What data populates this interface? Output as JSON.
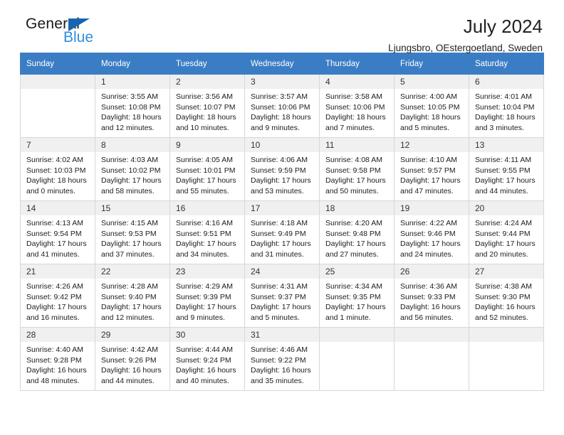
{
  "brand": {
    "word1": "General",
    "word2": "Blue",
    "triangle_color": "#1565b0",
    "word2_color": "#2e8ddb",
    "icon": "triangle-flag-icon"
  },
  "header": {
    "title": "July 2024",
    "subtitle": "Ljungsbro, OEstergoetland, Sweden"
  },
  "theme": {
    "header_row_bg": "#3b7dc4",
    "header_row_text": "#ffffff",
    "daynum_bg": "#f0f0f0",
    "cell_border": "#d7d7d7"
  },
  "calendar": {
    "weekday_headers": [
      "Sunday",
      "Monday",
      "Tuesday",
      "Wednesday",
      "Thursday",
      "Friday",
      "Saturday"
    ],
    "labels": {
      "sunrise": "Sunrise:",
      "sunset": "Sunset:",
      "daylight": "Daylight:"
    },
    "weeks": [
      [
        {
          "day": "",
          "empty": true
        },
        {
          "day": "1",
          "sunrise": "Sunrise: 3:55 AM",
          "sunset": "Sunset: 10:08 PM",
          "daylight1": "Daylight: 18 hours",
          "daylight2": "and 12 minutes."
        },
        {
          "day": "2",
          "sunrise": "Sunrise: 3:56 AM",
          "sunset": "Sunset: 10:07 PM",
          "daylight1": "Daylight: 18 hours",
          "daylight2": "and 10 minutes."
        },
        {
          "day": "3",
          "sunrise": "Sunrise: 3:57 AM",
          "sunset": "Sunset: 10:06 PM",
          "daylight1": "Daylight: 18 hours",
          "daylight2": "and 9 minutes."
        },
        {
          "day": "4",
          "sunrise": "Sunrise: 3:58 AM",
          "sunset": "Sunset: 10:06 PM",
          "daylight1": "Daylight: 18 hours",
          "daylight2": "and 7 minutes."
        },
        {
          "day": "5",
          "sunrise": "Sunrise: 4:00 AM",
          "sunset": "Sunset: 10:05 PM",
          "daylight1": "Daylight: 18 hours",
          "daylight2": "and 5 minutes."
        },
        {
          "day": "6",
          "sunrise": "Sunrise: 4:01 AM",
          "sunset": "Sunset: 10:04 PM",
          "daylight1": "Daylight: 18 hours",
          "daylight2": "and 3 minutes."
        }
      ],
      [
        {
          "day": "7",
          "sunrise": "Sunrise: 4:02 AM",
          "sunset": "Sunset: 10:03 PM",
          "daylight1": "Daylight: 18 hours",
          "daylight2": "and 0 minutes."
        },
        {
          "day": "8",
          "sunrise": "Sunrise: 4:03 AM",
          "sunset": "Sunset: 10:02 PM",
          "daylight1": "Daylight: 17 hours",
          "daylight2": "and 58 minutes."
        },
        {
          "day": "9",
          "sunrise": "Sunrise: 4:05 AM",
          "sunset": "Sunset: 10:01 PM",
          "daylight1": "Daylight: 17 hours",
          "daylight2": "and 55 minutes."
        },
        {
          "day": "10",
          "sunrise": "Sunrise: 4:06 AM",
          "sunset": "Sunset: 9:59 PM",
          "daylight1": "Daylight: 17 hours",
          "daylight2": "and 53 minutes."
        },
        {
          "day": "11",
          "sunrise": "Sunrise: 4:08 AM",
          "sunset": "Sunset: 9:58 PM",
          "daylight1": "Daylight: 17 hours",
          "daylight2": "and 50 minutes."
        },
        {
          "day": "12",
          "sunrise": "Sunrise: 4:10 AM",
          "sunset": "Sunset: 9:57 PM",
          "daylight1": "Daylight: 17 hours",
          "daylight2": "and 47 minutes."
        },
        {
          "day": "13",
          "sunrise": "Sunrise: 4:11 AM",
          "sunset": "Sunset: 9:55 PM",
          "daylight1": "Daylight: 17 hours",
          "daylight2": "and 44 minutes."
        }
      ],
      [
        {
          "day": "14",
          "sunrise": "Sunrise: 4:13 AM",
          "sunset": "Sunset: 9:54 PM",
          "daylight1": "Daylight: 17 hours",
          "daylight2": "and 41 minutes."
        },
        {
          "day": "15",
          "sunrise": "Sunrise: 4:15 AM",
          "sunset": "Sunset: 9:53 PM",
          "daylight1": "Daylight: 17 hours",
          "daylight2": "and 37 minutes."
        },
        {
          "day": "16",
          "sunrise": "Sunrise: 4:16 AM",
          "sunset": "Sunset: 9:51 PM",
          "daylight1": "Daylight: 17 hours",
          "daylight2": "and 34 minutes."
        },
        {
          "day": "17",
          "sunrise": "Sunrise: 4:18 AM",
          "sunset": "Sunset: 9:49 PM",
          "daylight1": "Daylight: 17 hours",
          "daylight2": "and 31 minutes."
        },
        {
          "day": "18",
          "sunrise": "Sunrise: 4:20 AM",
          "sunset": "Sunset: 9:48 PM",
          "daylight1": "Daylight: 17 hours",
          "daylight2": "and 27 minutes."
        },
        {
          "day": "19",
          "sunrise": "Sunrise: 4:22 AM",
          "sunset": "Sunset: 9:46 PM",
          "daylight1": "Daylight: 17 hours",
          "daylight2": "and 24 minutes."
        },
        {
          "day": "20",
          "sunrise": "Sunrise: 4:24 AM",
          "sunset": "Sunset: 9:44 PM",
          "daylight1": "Daylight: 17 hours",
          "daylight2": "and 20 minutes."
        }
      ],
      [
        {
          "day": "21",
          "sunrise": "Sunrise: 4:26 AM",
          "sunset": "Sunset: 9:42 PM",
          "daylight1": "Daylight: 17 hours",
          "daylight2": "and 16 minutes."
        },
        {
          "day": "22",
          "sunrise": "Sunrise: 4:28 AM",
          "sunset": "Sunset: 9:40 PM",
          "daylight1": "Daylight: 17 hours",
          "daylight2": "and 12 minutes."
        },
        {
          "day": "23",
          "sunrise": "Sunrise: 4:29 AM",
          "sunset": "Sunset: 9:39 PM",
          "daylight1": "Daylight: 17 hours",
          "daylight2": "and 9 minutes."
        },
        {
          "day": "24",
          "sunrise": "Sunrise: 4:31 AM",
          "sunset": "Sunset: 9:37 PM",
          "daylight1": "Daylight: 17 hours",
          "daylight2": "and 5 minutes."
        },
        {
          "day": "25",
          "sunrise": "Sunrise: 4:34 AM",
          "sunset": "Sunset: 9:35 PM",
          "daylight1": "Daylight: 17 hours",
          "daylight2": "and 1 minute."
        },
        {
          "day": "26",
          "sunrise": "Sunrise: 4:36 AM",
          "sunset": "Sunset: 9:33 PM",
          "daylight1": "Daylight: 16 hours",
          "daylight2": "and 56 minutes."
        },
        {
          "day": "27",
          "sunrise": "Sunrise: 4:38 AM",
          "sunset": "Sunset: 9:30 PM",
          "daylight1": "Daylight: 16 hours",
          "daylight2": "and 52 minutes."
        }
      ],
      [
        {
          "day": "28",
          "sunrise": "Sunrise: 4:40 AM",
          "sunset": "Sunset: 9:28 PM",
          "daylight1": "Daylight: 16 hours",
          "daylight2": "and 48 minutes."
        },
        {
          "day": "29",
          "sunrise": "Sunrise: 4:42 AM",
          "sunset": "Sunset: 9:26 PM",
          "daylight1": "Daylight: 16 hours",
          "daylight2": "and 44 minutes."
        },
        {
          "day": "30",
          "sunrise": "Sunrise: 4:44 AM",
          "sunset": "Sunset: 9:24 PM",
          "daylight1": "Daylight: 16 hours",
          "daylight2": "and 40 minutes."
        },
        {
          "day": "31",
          "sunrise": "Sunrise: 4:46 AM",
          "sunset": "Sunset: 9:22 PM",
          "daylight1": "Daylight: 16 hours",
          "daylight2": "and 35 minutes."
        },
        {
          "day": "",
          "empty": true
        },
        {
          "day": "",
          "empty": true
        },
        {
          "day": "",
          "empty": true
        }
      ]
    ]
  }
}
